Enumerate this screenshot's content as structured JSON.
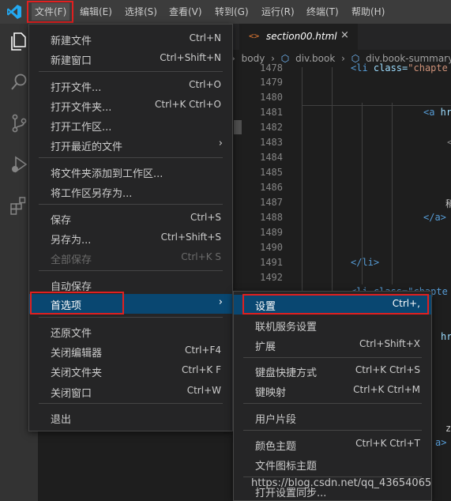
{
  "menubar": {
    "items": [
      "文件(F)",
      "编辑(E)",
      "选择(S)",
      "查看(V)",
      "转到(G)",
      "运行(R)",
      "终端(T)",
      "帮助(H)"
    ]
  },
  "colors": {
    "accent": "#094771",
    "highlight_box": "#e02020",
    "logo": "#23a9f2"
  },
  "tab": {
    "icon": "<>",
    "label": "section00.html",
    "close": "×"
  },
  "breadcrumb": [
    "body",
    "div.book",
    "div.book-summary"
  ],
  "lines": [
    "1478",
    "1479",
    "1480",
    "1481",
    "1482",
    "1483",
    "1484",
    "1485",
    "1486",
    "1487",
    "1488",
    "1489",
    "1490",
    "1491",
    "1492"
  ],
  "code": {
    "l1478_a": "<li",
    "l1478_b": " class=",
    "l1478_c": "\"chapte",
    "l1481_a": "<a",
    "l1481_b": " hr",
    "l1484_b": "<",
    "l1487_a": "稍",
    "l1488_a": "</a>",
    "l1491_a": "</li>",
    "l1493_a": "<li class=\"chapte",
    "r_hr": "hr",
    "r_z": "z",
    "r_a": "a>"
  },
  "file_menu": {
    "items": [
      {
        "label": "新建文件",
        "key": "Ctrl+N"
      },
      {
        "label": "新建窗口",
        "key": "Ctrl+Shift+N"
      },
      {
        "label": "打开文件...",
        "key": "Ctrl+O"
      },
      {
        "label": "打开文件夹...",
        "key": "Ctrl+K Ctrl+O"
      },
      {
        "label": "打开工作区...",
        "key": ""
      },
      {
        "label": "打开最近的文件",
        "key": "",
        "arrow": "›"
      },
      {
        "label": "将文件夹添加到工作区...",
        "key": ""
      },
      {
        "label": "将工作区另存为...",
        "key": ""
      },
      {
        "label": "保存",
        "key": "Ctrl+S"
      },
      {
        "label": "另存为...",
        "key": "Ctrl+Shift+S"
      },
      {
        "label": "全部保存",
        "key": "Ctrl+K S"
      },
      {
        "label": "自动保存",
        "key": ""
      },
      {
        "label": "首选项",
        "key": "",
        "arrow": "›"
      },
      {
        "label": "还原文件",
        "key": ""
      },
      {
        "label": "关闭编辑器",
        "key": "Ctrl+F4"
      },
      {
        "label": "关闭文件夹",
        "key": "Ctrl+K F"
      },
      {
        "label": "关闭窗口",
        "key": "Ctrl+W"
      },
      {
        "label": "退出",
        "key": ""
      }
    ]
  },
  "pref_menu": {
    "items": [
      {
        "label": "设置",
        "key": "Ctrl+,"
      },
      {
        "label": "联机服务设置",
        "key": ""
      },
      {
        "label": "扩展",
        "key": "Ctrl+Shift+X"
      },
      {
        "label": "键盘快捷方式",
        "key": "Ctrl+K Ctrl+S"
      },
      {
        "label": "键映射",
        "key": "Ctrl+K Ctrl+M"
      },
      {
        "label": "用户片段",
        "key": ""
      },
      {
        "label": "颜色主题",
        "key": "Ctrl+K Ctrl+T"
      },
      {
        "label": "文件图标主题",
        "key": ""
      },
      {
        "label": "打开设置同步...",
        "key": ""
      }
    ]
  },
  "watermark": "https://blog.csdn.net/qq_43654065",
  "icons": [
    "vscode-logo-icon",
    "explorer-icon",
    "search-icon",
    "source-control-icon",
    "run-debug-icon",
    "extensions-icon",
    "html-file-icon",
    "close-icon",
    "chevron-right-icon"
  ]
}
